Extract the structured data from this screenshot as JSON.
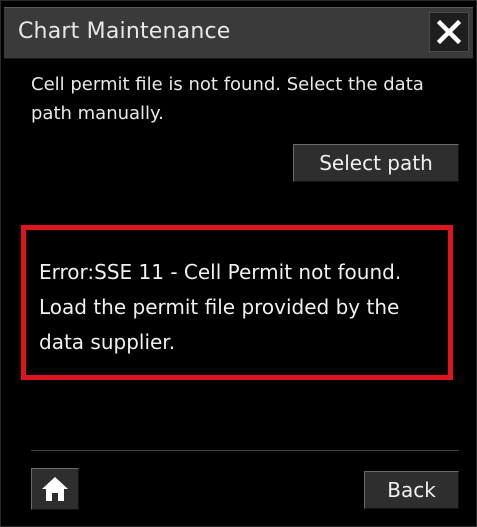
{
  "dialog": {
    "title": "Chart Maintenance",
    "close_icon": "close-icon"
  },
  "message": {
    "text": "Cell permit file is not found. Select the data path manually."
  },
  "actions": {
    "select_path_label": "Select path",
    "back_label": "Back",
    "home_icon": "home-icon"
  },
  "error": {
    "text": "Error:SSE 11 - Cell Permit not found. Load the permit file provided by the data supplier.",
    "highlight_color": "#e0141c"
  },
  "colors": {
    "background": "#000000",
    "title_bar": "#3a3a3a",
    "button": "#2e2e2e",
    "text": "#f0f0f0"
  }
}
